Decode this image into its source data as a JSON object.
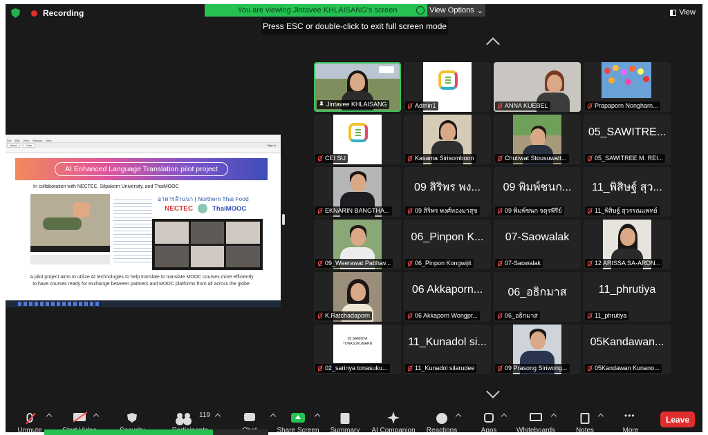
{
  "status": {
    "recording": "Recording"
  },
  "banner": {
    "viewing": "You are viewing Jintavee KHLAISANG's screen",
    "view_options": "View Options",
    "esc_hint": "Press ESC or double-click to exit full screen mode",
    "view": "View"
  },
  "shared_screen": {
    "window_title": "...",
    "menu": [
      "File",
      "Edit",
      "View",
      "Window",
      "Help"
    ],
    "tabs": [
      "Home",
      "Tools"
    ],
    "sign_in": "Sign In",
    "slide": {
      "title": "AI Enhanced Language Translation pilot project",
      "collab": "In collaboration with NECTEC, Silpakorn University, and ThaiMOOC",
      "thai_title": "อาหารล้านนา | Northern Thai Food",
      "logo_nectec": "NECTEC",
      "logo_thaimooc": "ThaiMOOC",
      "description": "A pilot project aims to utilize AI technologies to help translate to translate MOOC courses more efficiently to have courses ready for exchange between partners and MOOC platforms from all across the globe."
    }
  },
  "participants": [
    {
      "name": "Jintavee KHLAISANG",
      "video": "photo",
      "pinned": true,
      "muted": false,
      "active": true
    },
    {
      "name": "Admin1",
      "video": "logo",
      "muted": true
    },
    {
      "name": "ANNA KUEBEL",
      "video": "photo",
      "muted": true
    },
    {
      "name": "Prapaporn Nongharn...",
      "video": "photo",
      "muted": true
    },
    {
      "name": "CEI SU",
      "video": "logo",
      "muted": true
    },
    {
      "name": "Kasama Sirisomboon",
      "video": "photo",
      "muted": true
    },
    {
      "name": "Chutiwat Stousuwatt...",
      "video": "photo",
      "muted": true
    },
    {
      "name": "05_SAWITREE M. REI...",
      "display": "05_SAWITRE...",
      "muted": true
    },
    {
      "name": "EKNARIN BANGTHA...",
      "video": "photo",
      "muted": true
    },
    {
      "name": "09 สิริพร พงศ์ทองมาสุข",
      "display": "09 สิริพร พง...",
      "muted": true
    },
    {
      "name": "09 พิมพ์ชนก จตุรพีรีย์",
      "display": "09 พิมพ์ชนก...",
      "muted": true
    },
    {
      "name": "11_พิสิษฐ์ สุวรรณแพทย์",
      "display": "11_พิสิษฐ์ สุว...",
      "muted": true
    },
    {
      "name": "09_Weerawat Patthav...",
      "video": "photo",
      "muted": true
    },
    {
      "name": "06_Pinpon Kongwijit",
      "display": "06_Pinpon K...",
      "muted": true
    },
    {
      "name": "07-Saowalak",
      "display": "07-Saowalak",
      "muted": true
    },
    {
      "name": "12 ARISSA SA-ARDN...",
      "video": "photo",
      "muted": true
    },
    {
      "name": "K.Ratchadaporn",
      "video": "photo",
      "muted": true
    },
    {
      "name": "06 Akkaporn Wongpr...",
      "display": "06 Akkaporn...",
      "muted": true
    },
    {
      "name": "06_อธิกมาส",
      "display": "06_อธิกมาส",
      "muted": true
    },
    {
      "name": "11_phrutiya",
      "display": "11_phrutiya",
      "muted": true
    },
    {
      "name": "02_sarinya tonasuku...",
      "video": "card",
      "card_text": "02 SARINYA TONASUKUMARN",
      "muted": true
    },
    {
      "name": "11_Kunadol silarudee",
      "display": "11_Kunadol si...",
      "muted": true
    },
    {
      "name": "09 Prasong Siriwong...",
      "video": "photo",
      "muted": true
    },
    {
      "name": "05Kandawan Kunano...",
      "display": "05Kandawan...",
      "muted": true
    }
  ],
  "toolbar": {
    "unmute": "Unmute",
    "start_video": "Start Video",
    "security": "Security",
    "participants": "Participants",
    "participants_count": "119",
    "chat": "Chat",
    "share_screen": "Share Screen",
    "summary": "Summary",
    "ai_companion": "AI Companion",
    "reactions": "Reactions",
    "apps": "Apps",
    "whiteboards": "Whiteboards",
    "notes": "Notes",
    "more": "More",
    "leave": "Leave"
  }
}
